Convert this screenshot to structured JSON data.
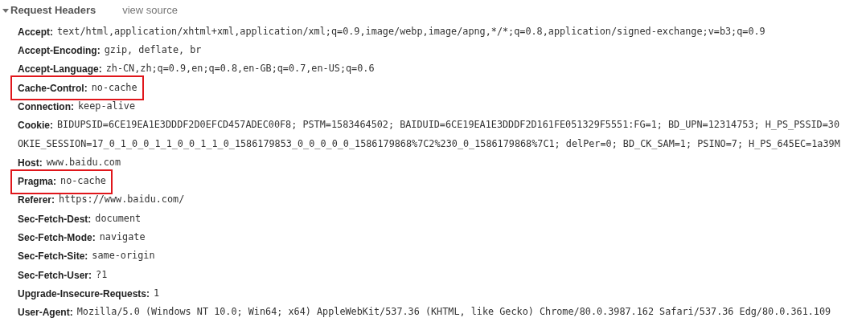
{
  "section": {
    "title": "Request Headers",
    "expanded": true,
    "link": "view source"
  },
  "headers": [
    {
      "name": "Accept:",
      "value_lines": [
        "text/html,application/xhtml+xml,application/xml;q=0.9,image/webp,image/apng,*/*;q=0.8,application/signed-exchange;v=b3;q=0.9"
      ],
      "highlighted": false
    },
    {
      "name": "Accept-Encoding:",
      "value_lines": [
        "gzip, deflate, br"
      ],
      "highlighted": false
    },
    {
      "name": "Accept-Language:",
      "value_lines": [
        "zh-CN,zh;q=0.9,en;q=0.8,en-GB;q=0.7,en-US;q=0.6"
      ],
      "highlighted": false
    },
    {
      "name": "Cache-Control:",
      "value_lines": [
        "no-cache"
      ],
      "highlighted": true
    },
    {
      "name": "Connection:",
      "value_lines": [
        "keep-alive"
      ],
      "highlighted": false
    },
    {
      "name": "Cookie:",
      "value_lines": [
        "BIDUPSID=6CE19EA1E3DDDF2D0EFCD457ADEC00F8; PSTM=1583464502; BAIDUID=6CE19EA1E3DDDF2D161FE051329F5551:FG=1; BD_UPN=12314753; H_PS_PSSID=30",
        "OKIE_SESSION=17_0_1_0_0_1_1_0_0_1_1_0_1586179853_0_0_0_0_0_1586179868%7C2%230_0_1586179868%7C1; delPer=0; BD_CK_SAM=1; PSINO=7; H_PS_645EC=1a39M"
      ],
      "highlighted": false
    },
    {
      "name": "Host:",
      "value_lines": [
        "www.baidu.com"
      ],
      "highlighted": false
    },
    {
      "name": "Pragma:",
      "value_lines": [
        "no-cache"
      ],
      "highlighted": true
    },
    {
      "name": "Referer:",
      "value_lines": [
        "https://www.baidu.com/"
      ],
      "highlighted": false
    },
    {
      "name": "Sec-Fetch-Dest:",
      "value_lines": [
        "document"
      ],
      "highlighted": false
    },
    {
      "name": "Sec-Fetch-Mode:",
      "value_lines": [
        "navigate"
      ],
      "highlighted": false
    },
    {
      "name": "Sec-Fetch-Site:",
      "value_lines": [
        "same-origin"
      ],
      "highlighted": false
    },
    {
      "name": "Sec-Fetch-User:",
      "value_lines": [
        "?1"
      ],
      "highlighted": false
    },
    {
      "name": "Upgrade-Insecure-Requests:",
      "value_lines": [
        "1"
      ],
      "highlighted": false
    },
    {
      "name": "User-Agent:",
      "value_lines": [
        "Mozilla/5.0 (Windows NT 10.0; Win64; x64) AppleWebKit/537.36 (KHTML, like Gecko) Chrome/80.0.3987.162 Safari/537.36 Edg/80.0.361.109"
      ],
      "highlighted": false
    }
  ]
}
